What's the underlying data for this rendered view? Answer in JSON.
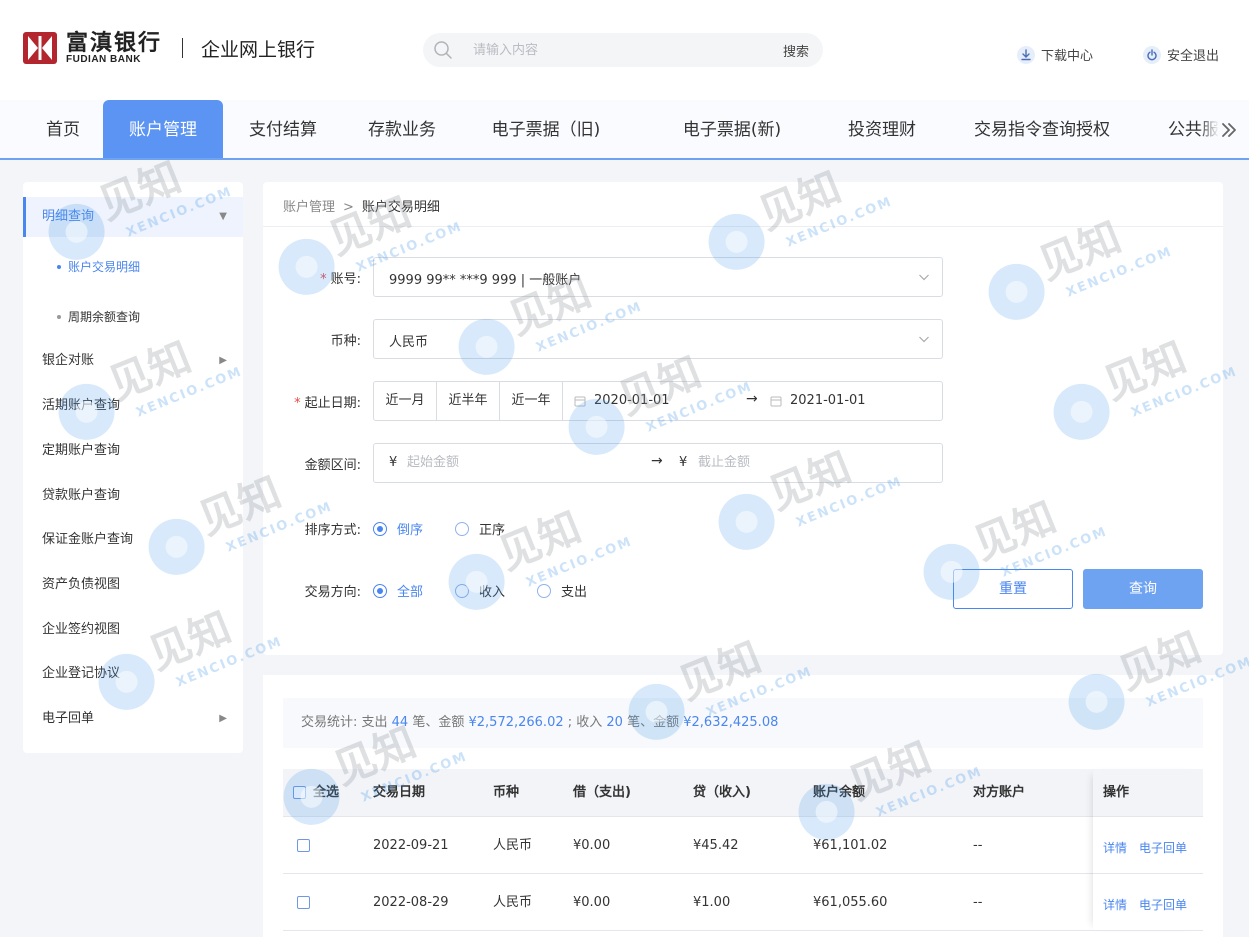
{
  "header": {
    "brand_cn": "富滇银行",
    "brand_en": "FUDIAN BANK",
    "site_title": "企业网上银行",
    "brand_color": "#b3262e",
    "search": {
      "placeholder": "请输入内容",
      "button": "搜索"
    },
    "links": {
      "download": "下载中心",
      "logout": "安全退出"
    }
  },
  "nav": {
    "items": [
      "首页",
      "账户管理",
      "支付结算",
      "存款业务",
      "电子票据（旧)",
      "电子票据(新)",
      "投资理财",
      "交易指令查询授权",
      "公共服务"
    ],
    "active_index": 1,
    "more_icon": "double-chevron-right-icon"
  },
  "sidebar": {
    "items": [
      {
        "label": "明细查询",
        "expanded": true
      },
      {
        "label": "账户交易明细",
        "sub": true,
        "active": true
      },
      {
        "label": "周期余额查询",
        "sub": true
      },
      {
        "label": "银企对账",
        "has_children": true
      },
      {
        "label": "活期账户查询"
      },
      {
        "label": "定期账户查询"
      },
      {
        "label": "贷款账户查询"
      },
      {
        "label": "保证金账户查询"
      },
      {
        "label": "资产负债视图"
      },
      {
        "label": "企业签约视图"
      },
      {
        "label": "企业登记协议"
      },
      {
        "label": "电子回单",
        "has_children": true
      }
    ]
  },
  "breadcrumb": {
    "parent": "账户管理",
    "separator": ">",
    "current": "账户交易明细"
  },
  "form": {
    "account": {
      "label": "账号:",
      "required": true,
      "value": "9999 99** ***9 999 | 一般账户"
    },
    "currency": {
      "label": "币种:",
      "value": "人民币"
    },
    "date_range": {
      "label": "起止日期:",
      "required": true,
      "quick": [
        "近一月",
        "近半年",
        "近一年"
      ],
      "start": "2020-01-01",
      "end": "2021-01-01",
      "arrow": "→"
    },
    "amount_range": {
      "label": "金额区间:",
      "currency_symbol": "¥",
      "start_placeholder": "起始金额",
      "end_placeholder": "截止金额",
      "arrow": "→"
    },
    "sort": {
      "label": "排序方式:",
      "options": [
        "倒序",
        "正序"
      ],
      "selected": 0
    },
    "direction": {
      "label": "交易方向:",
      "options": [
        "全部",
        "收入",
        "支出"
      ],
      "selected": 0
    },
    "buttons": {
      "reset": "重置",
      "query": "查询"
    }
  },
  "stats": {
    "prefix": "交易统计: 支出",
    "expense_count": "44",
    "mid1": "笔、金额",
    "expense_amount": "¥2,572,266.02",
    "mid2": "; 收入",
    "income_count": "20",
    "mid3": "笔、金额",
    "income_amount": "¥2,632,425.08"
  },
  "table": {
    "columns": [
      "全选",
      "交易日期",
      "币种",
      "借（支出)",
      "贷（收入)",
      "账户余额",
      "对方账户",
      "操作"
    ],
    "rows": [
      {
        "date": "2022-09-21",
        "currency": "人民币",
        "debit": "¥0.00",
        "credit": "¥45.42",
        "balance": "¥61,101.02",
        "counterparty": "--",
        "actions": [
          "详情",
          "电子回单"
        ]
      },
      {
        "date": "2022-08-29",
        "currency": "人民币",
        "debit": "¥0.00",
        "credit": "¥1.00",
        "balance": "¥61,055.60",
        "counterparty": "--",
        "actions": [
          "详情",
          "电子回单"
        ]
      }
    ]
  },
  "watermark": {
    "cn": "见知",
    "en": "XENCIO.COM",
    "color": "#4a9be8"
  }
}
